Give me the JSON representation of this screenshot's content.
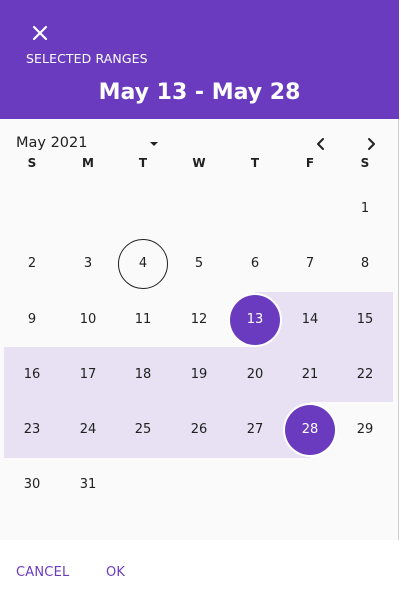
{
  "header": {
    "close_icon": "close-icon",
    "label": "SELECTED RANGES",
    "title": "May 13 - May 28",
    "color": "#6a3bbf"
  },
  "calendar": {
    "month_label": "May 2021",
    "dropdown_icon": "caret-down-icon",
    "prev_icon": "chevron-left-icon",
    "next_icon": "chevron-right-icon",
    "weekdays": [
      "S",
      "M",
      "T",
      "W",
      "T",
      "F",
      "S"
    ],
    "days": [
      "1",
      "2",
      "3",
      "4",
      "5",
      "6",
      "7",
      "8",
      "9",
      "10",
      "11",
      "12",
      "13",
      "14",
      "15",
      "16",
      "17",
      "18",
      "19",
      "20",
      "21",
      "22",
      "23",
      "24",
      "25",
      "26",
      "27",
      "28",
      "29",
      "30",
      "31"
    ],
    "today": "4",
    "range_start": "13",
    "range_end": "28",
    "range_color": "#e7e1f3"
  },
  "footer": {
    "cancel_label": "CANCEL",
    "ok_label": "OK"
  }
}
